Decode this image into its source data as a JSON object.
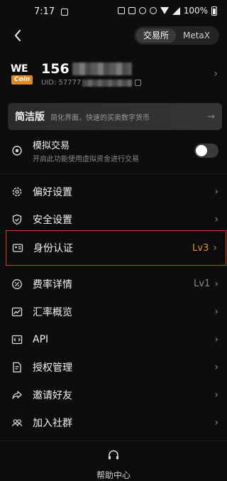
{
  "status_bar": {
    "time": "7:17",
    "battery": "100%"
  },
  "header": {
    "tabs": [
      "交易所",
      "MetaX"
    ],
    "active_tab": 0
  },
  "profile": {
    "logo_top": "WE",
    "logo_bottom": "Coin",
    "phone_prefix": "156",
    "uid_prefix": "UID: 57777"
  },
  "banner": {
    "title": "简洁版",
    "subtitle": "简化界面，快速的买卖数字货币"
  },
  "simulated": {
    "label": "模拟交易",
    "description": "开启此功能使用虚拟资金进行交易",
    "enabled": false
  },
  "menu": [
    {
      "label": "偏好设置",
      "icon": "gear-icon",
      "value": ""
    },
    {
      "label": "安全设置",
      "icon": "shield-icon",
      "value": ""
    },
    {
      "label": "身份认证",
      "icon": "id-card-icon",
      "value": "Lv3",
      "value_color": "#e8922a",
      "highlight": true
    },
    {
      "label": "费率详情",
      "icon": "percent-icon",
      "value": "Lv1",
      "value_color": "#8a8a8a"
    },
    {
      "label": "汇率概览",
      "icon": "chart-icon",
      "value": ""
    },
    {
      "label": "API",
      "icon": "code-icon",
      "value": ""
    },
    {
      "label": "授权管理",
      "icon": "document-icon",
      "value": ""
    },
    {
      "label": "邀请好友",
      "icon": "share-icon",
      "value": ""
    },
    {
      "label": "加入社群",
      "icon": "community-icon",
      "value": ""
    }
  ],
  "footer": {
    "help_label": "帮助中心"
  },
  "colors": {
    "accent": "#e8922a",
    "highlight_border": "#d23a3a"
  }
}
